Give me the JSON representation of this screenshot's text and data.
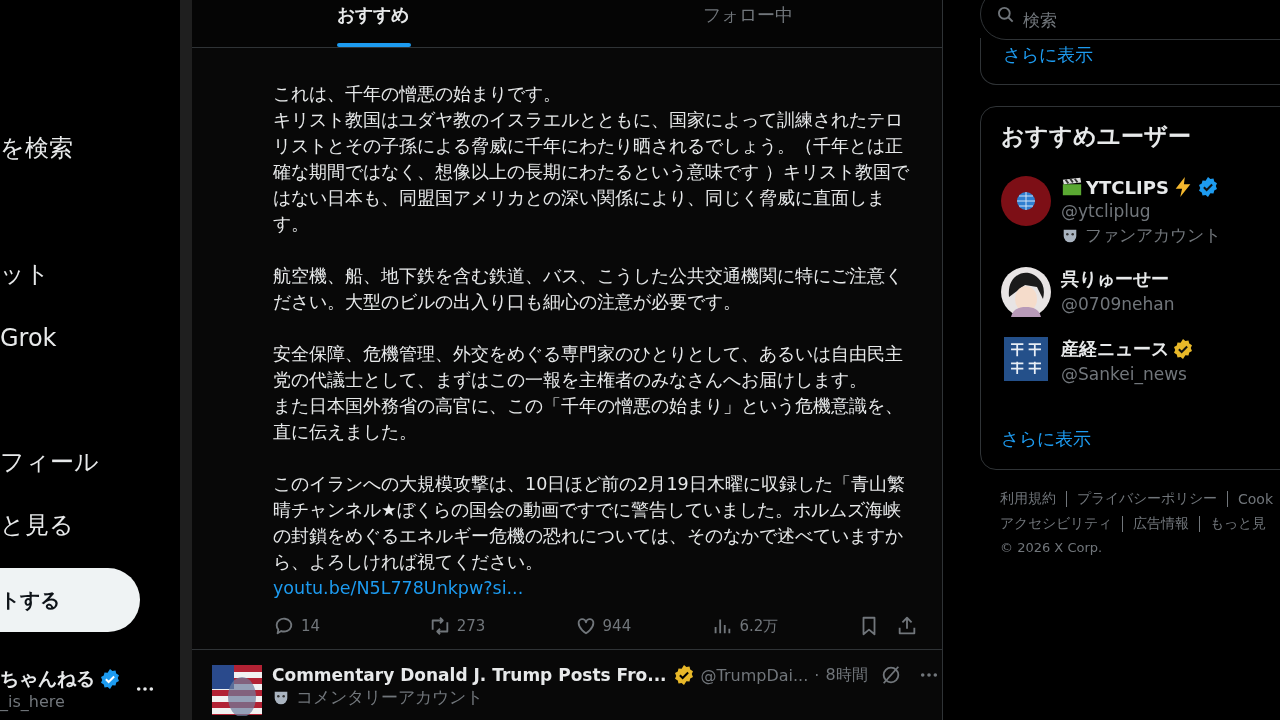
{
  "sidebar": {
    "items": [
      {
        "label": "を検索"
      },
      {
        "label": "ット"
      },
      {
        "label": "Grok"
      },
      {
        "label": "フィール"
      },
      {
        "label": "と見る"
      }
    ],
    "post_button": "トする",
    "account": {
      "name": "ちゃんねる",
      "handle": "_is_here",
      "badge": {
        "color": "#1d9bf0"
      }
    }
  },
  "tabs": [
    {
      "label": "おすすめ",
      "selected": true
    },
    {
      "label": "フォロー中",
      "selected": false
    }
  ],
  "post": {
    "paragraphs": [
      [
        "これは、千年の憎悪の始まりです。",
        "キリスト教国はユダヤ教のイスラエルとともに、国家によって訓練されたテロリストとその子孫による脅威に千年にわたり晒されるでしょう。（千年とは正確な期間ではなく、想像以上の長期にわたるという意味です ）キリスト教国ではない日本も、同盟国アメリカとの深い関係により、同じく脅威に直面します。"
      ],
      [
        "航空機、船、地下鉄を含む鉄道、バス、こうした公共交通機関に特にご注意ください。大型のビルの出入り口も細心の注意が必要です。"
      ],
      [
        "安全保障、危機管理、外交をめぐる専門家のひとりとして、あるいは自由民主党の代議士として、まずはこの一報を主権者のみなさんへお届けします。",
        "また日本国外務省の高官に、この「千年の憎悪の始まり」という危機意識を、直に伝えました。"
      ],
      [
        "このイランへの大規模攻撃は、10日ほど前の2月19日木曜に収録した「青山繁晴チャンネル★ぼくらの国会の動画ですでに警告していました。ホルムズ海峡の封鎖をめぐるエネルギー危機の恐れについては、そのなかで述べていますから、よろしければ視てください。"
      ]
    ],
    "link": "youtu.be/N5L778Unkpw?si...",
    "actions": [
      {
        "kind": "reply",
        "count": "14"
      },
      {
        "kind": "repost",
        "count": "273"
      },
      {
        "kind": "like",
        "count": "944"
      },
      {
        "kind": "views",
        "count": "6.2万"
      },
      {
        "kind": "bookmark"
      },
      {
        "kind": "share"
      }
    ]
  },
  "next_post": {
    "name": "Commentary Donald J. Trump Posts Fro...",
    "badge": {
      "color": "#e8b829"
    },
    "handle": "@TrumpDai...",
    "separator": "·",
    "time": "8時間",
    "label": "コメンタリーアカウント"
  },
  "search": {
    "placeholder": "検索"
  },
  "trends": {
    "show_more": "さらに表示"
  },
  "who_to_follow": {
    "title": "おすすめユーザー",
    "users": [
      {
        "kind": "clips",
        "name": "YTCLIPS",
        "handle": "@ytcliplug",
        "badge": {
          "color": "#1d9bf0"
        },
        "label": "ファンアカウント"
      },
      {
        "kind": "anime",
        "name": "呉りゅーせー",
        "handle": "@0709nehan"
      },
      {
        "kind": "news",
        "name": "産経ニュース",
        "handle": "@Sankei_news",
        "badge": {
          "color": "#e8b829"
        }
      }
    ],
    "show_more": "さらに表示"
  },
  "footer": {
    "rows": [
      [
        "利用規約",
        "プライバシーポリシー",
        "Cook"
      ],
      [
        "アクセシビリティ",
        "広告情報",
        "もっと見"
      ]
    ],
    "copyright": "© 2026 X Corp."
  }
}
